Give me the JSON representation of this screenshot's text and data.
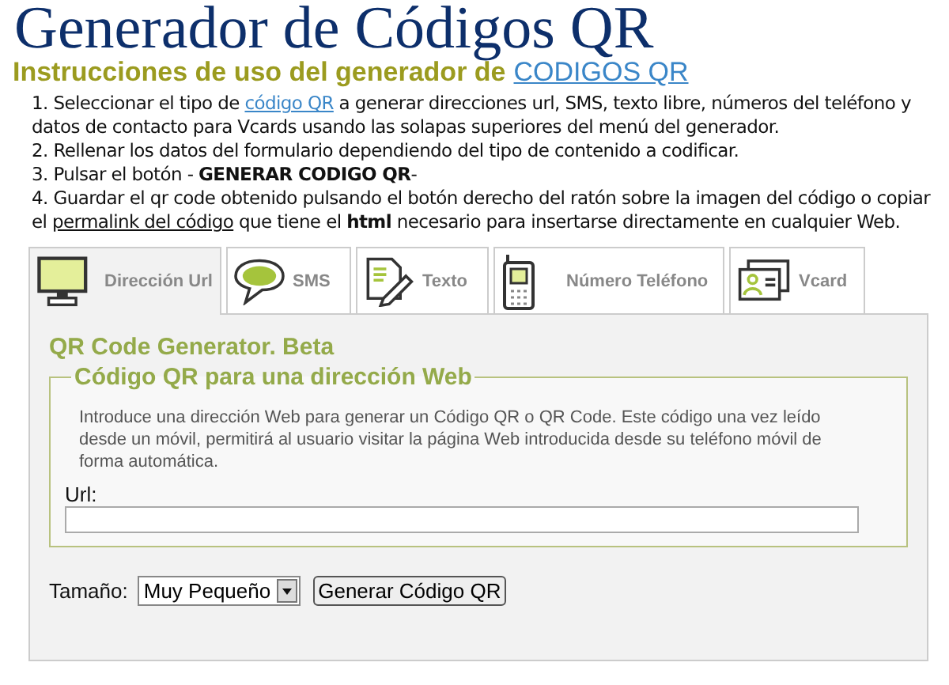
{
  "title": "Generador de Códigos QR",
  "subtitle": {
    "text": "Instrucciones de uso del generador de",
    "link": "CODIGOS QR"
  },
  "steps": [
    [
      {
        "kind": "text",
        "text": "1. Seleccionar el tipo de "
      },
      {
        "kind": "link",
        "text": "código QR"
      },
      {
        "kind": "text",
        "text": " a generar direcciones url,  SMS, texto libre, números del teléfono y datos de contacto para Vcards usando las solapas superiores del menú del generador."
      }
    ],
    [
      {
        "kind": "text",
        "text": "2. Rellenar los datos del formulario dependiendo del tipo de contenido a codificar."
      }
    ],
    [
      {
        "kind": "text",
        "text": "3. Pulsar el botón - **GENERAR CODIGO QR**-"
      }
    ],
    [
      {
        "kind": "text",
        "text": "4. Guardar el qr code obtenido pulsando el botón derecho del ratón sobre la imagen del código o copiar el "
      },
      {
        "kind": "underline",
        "text": "permalink del código"
      },
      {
        "kind": "text",
        "text": " que tiene el **html** necesario para insertarse directamente en cualquier Web."
      }
    ]
  ],
  "tabs": [
    {
      "label": "Dirección Url",
      "kind": "monitor",
      "selected": true
    },
    {
      "label": "SMS",
      "kind": "sms",
      "selected": false
    },
    {
      "label": "Texto",
      "kind": "text",
      "selected": false
    },
    {
      "label": "Número Teléfono",
      "kind": "phone",
      "selected": false
    },
    {
      "label": "Vcard",
      "kind": "vcard",
      "selected": false
    }
  ],
  "panel": {
    "heading": "QR Code Generator. Beta",
    "legend": "Código QR para una dirección Web",
    "description": "Introduce una dirección Web para generar un Código QR o QR Code. Este código una vez leído desde un móvil, permitirá al usuario visitar la página Web introducida desde su teléfono móvil de forma automática.",
    "field_label": "Url:",
    "size_label": "Tamaño:",
    "size_value": "Muy Pequeño",
    "button": "Generar Código QR"
  }
}
